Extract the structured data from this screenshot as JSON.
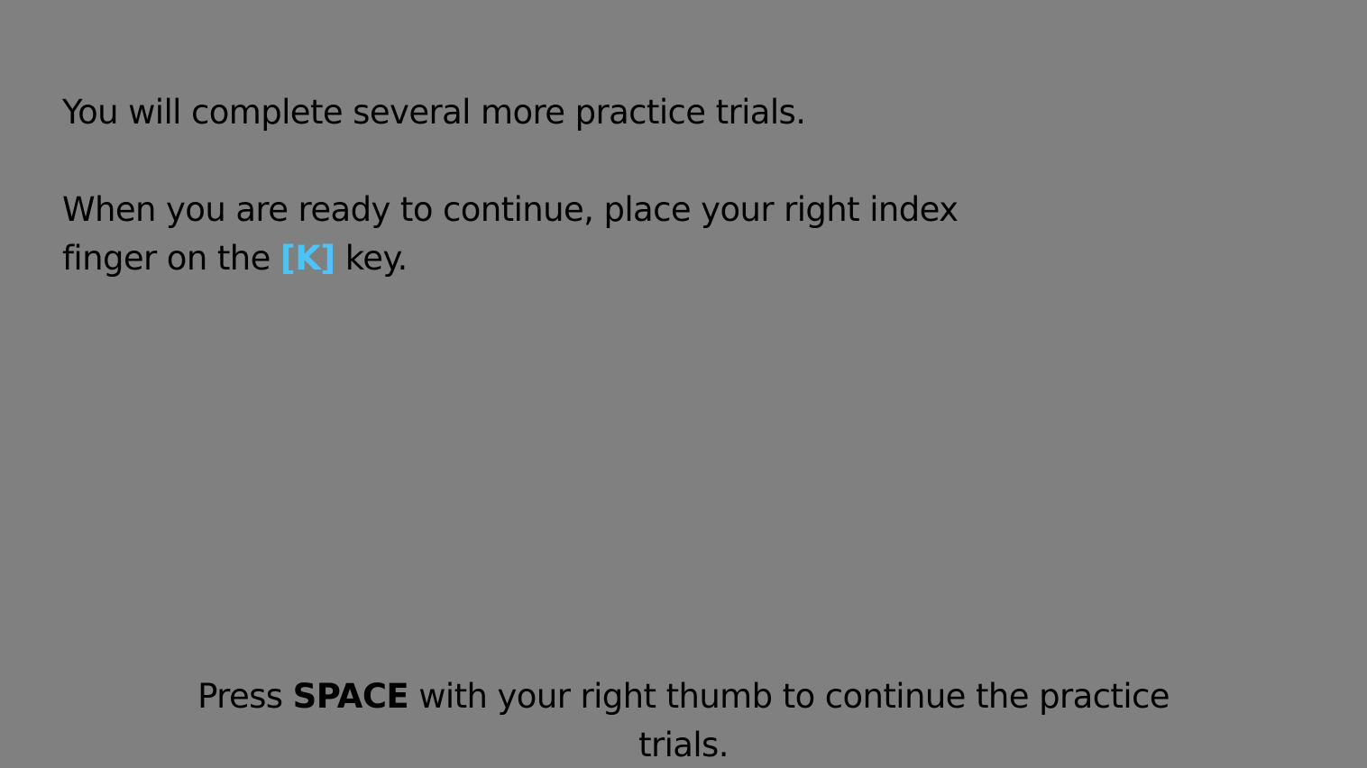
{
  "instructions": {
    "line1": "You will complete several more practice trials.",
    "line2_before": "When you are ready to continue, place your right index finger on the",
    "key_label": "[K]",
    "line2_after": "key."
  },
  "footer": {
    "before": "Press",
    "key": "SPACE",
    "after": "with your right thumb to continue the practice trials."
  },
  "colors": {
    "background": "#808080",
    "text": "#000000",
    "key_highlight": "#4fc3f7"
  }
}
